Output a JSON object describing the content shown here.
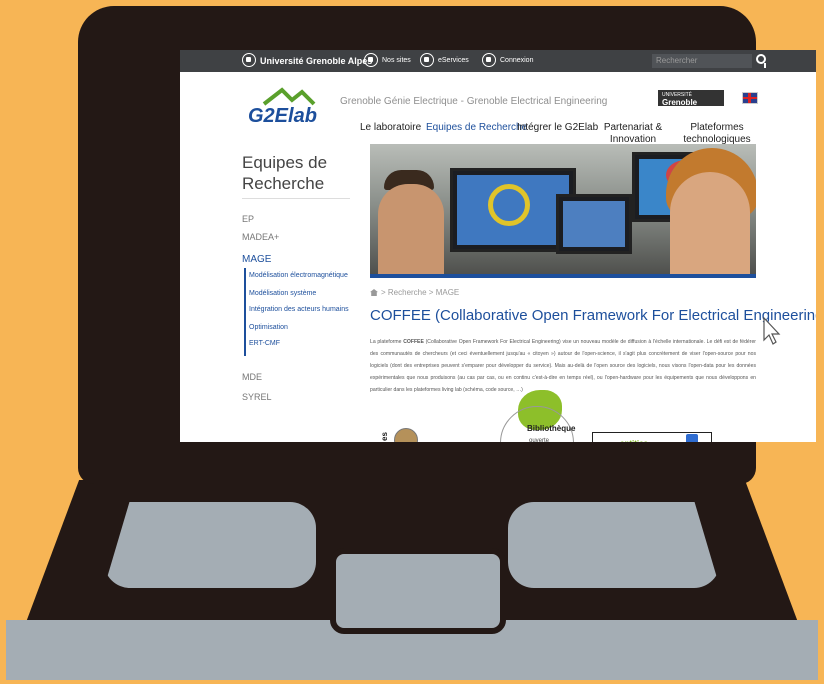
{
  "topbar": {
    "university": "Université Grenoble Alpes",
    "sites": "Nos sites",
    "services": "eServices",
    "contact": "Connexion",
    "search_placeholder": "Rechercher"
  },
  "header": {
    "logo": "G2Elab",
    "tagline": "Grenoble Génie Electrique - Grenoble Electrical Engineering",
    "uga_top": "UNIVERSITÉ",
    "uga_name": "Grenoble Alpes"
  },
  "nav": {
    "items": [
      "Le laboratoire",
      "Equipes de Recherche",
      "Intégrer le G2Elab",
      "Partenariat & Innovation",
      "Plateformes technologiques"
    ]
  },
  "sidebar": {
    "title": "Equipes de Recherche",
    "items": [
      "EP",
      "MADEA+",
      "MAGE",
      "MDE",
      "SYREL"
    ],
    "subitems": [
      "Modélisation électromagnétique",
      "Modélisation système",
      "Intégration des acteurs humains",
      "Optimisation",
      "ERT-CMF"
    ]
  },
  "content": {
    "breadcrumb": "> Recherche > MAGE",
    "title": "COFFEE (Collaborative Open Framework For Electrical Engineering)",
    "body_pre": "La plateforme ",
    "body_bold": "COFFEE",
    "body_post": " (Collaborative Open Framework For Electrical Engineering) vise un nouveau modèle de diffusion à l'échelle internationale. Le défi est de fédérer des communautés de chercheurs (et ceci éventuellement jusqu'au « citoyen ») autour de l'open-science, il s'agit plus concrètement de viser l'open-source pour nos logiciels (dont des entreprises peuvent s'emparer pour développer du service). Mais au-delà de l'open source des logiciels, nous visons l'open-data pour les données expérimentales que nous produisons (au cas par cas, ou en continu c'est-à-dire en temps réel), ou l'open-hardware pour les équipements que nous développons en particulier dans les plateformes living lab (schéma, code source, …)",
    "diagram_center": "Bibliothèque",
    "diagram_center_sub": "ouverte",
    "diagram_left": "es",
    "diagram_right": "entities"
  },
  "colors": {
    "brand": "#1d4f9c",
    "background": "#f7b555",
    "laptop": "#231815",
    "keys": "#a4adb4"
  }
}
